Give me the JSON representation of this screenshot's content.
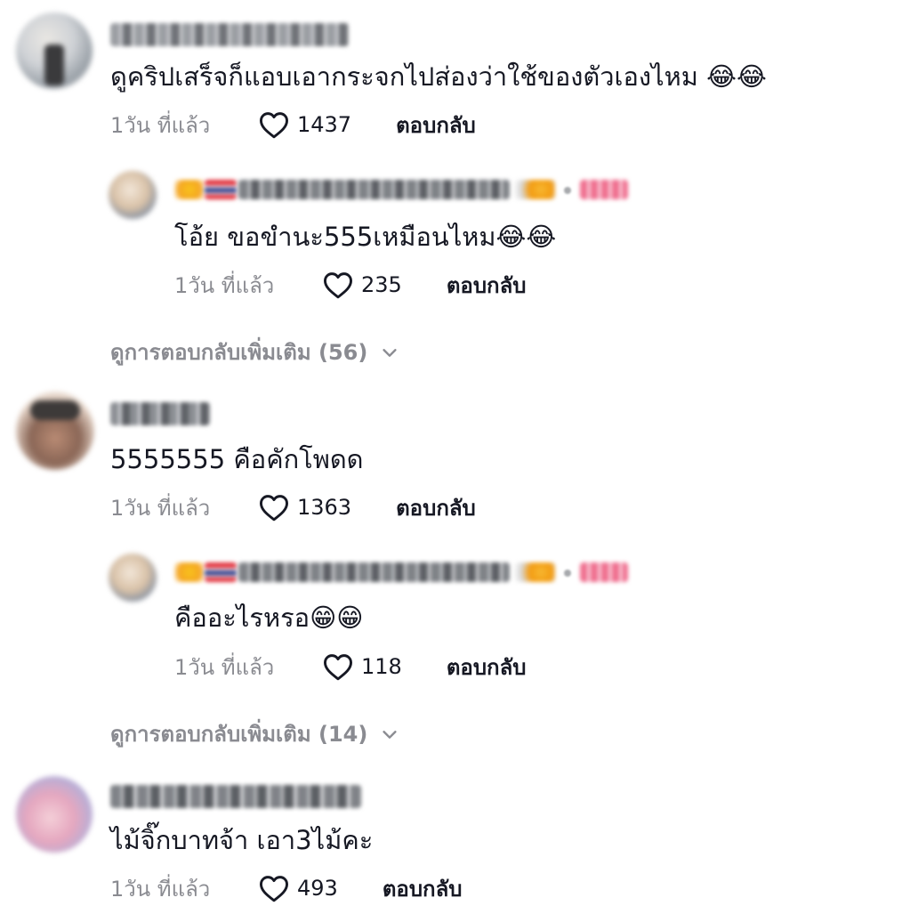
{
  "comments": [
    {
      "text": "ดูคริปเสร็จก็แอบเอากระจกไปส่องว่าใช้ของตัวเองไหม 😂😂",
      "time": "1วัน ที่แล้ว",
      "likes": "1437",
      "reply_label": "ตอบกลับ",
      "reply": {
        "text": "โอ้ย ขอขำนะ555เหมือนไหม😂😂",
        "time": "1วัน ที่แล้ว",
        "likes": "235",
        "reply_label": "ตอบกลับ"
      },
      "more_replies": "ดูการตอบกลับเพิ่มเติม (56)"
    },
    {
      "text": "5555555 คือคักโพดด",
      "time": "1วัน ที่แล้ว",
      "likes": "1363",
      "reply_label": "ตอบกลับ",
      "reply": {
        "text": "คืออะไรหรอ😁😁",
        "time": "1วัน ที่แล้ว",
        "likes": "118",
        "reply_label": "ตอบกลับ"
      },
      "more_replies": "ดูการตอบกลับเพิ่มเติม (14)"
    },
    {
      "text": "ไม้จิ๊กบาทจ้า เอา3ไม้คะ",
      "time": "1วัน ที่แล้ว",
      "likes": "493",
      "reply_label": "ตอบกลับ"
    }
  ],
  "icons": {
    "like": "heart-outline-icon",
    "expand": "chevron-down-icon"
  },
  "colors": {
    "text": "#161823",
    "muted": "#8a8b91",
    "background": "#ffffff"
  }
}
